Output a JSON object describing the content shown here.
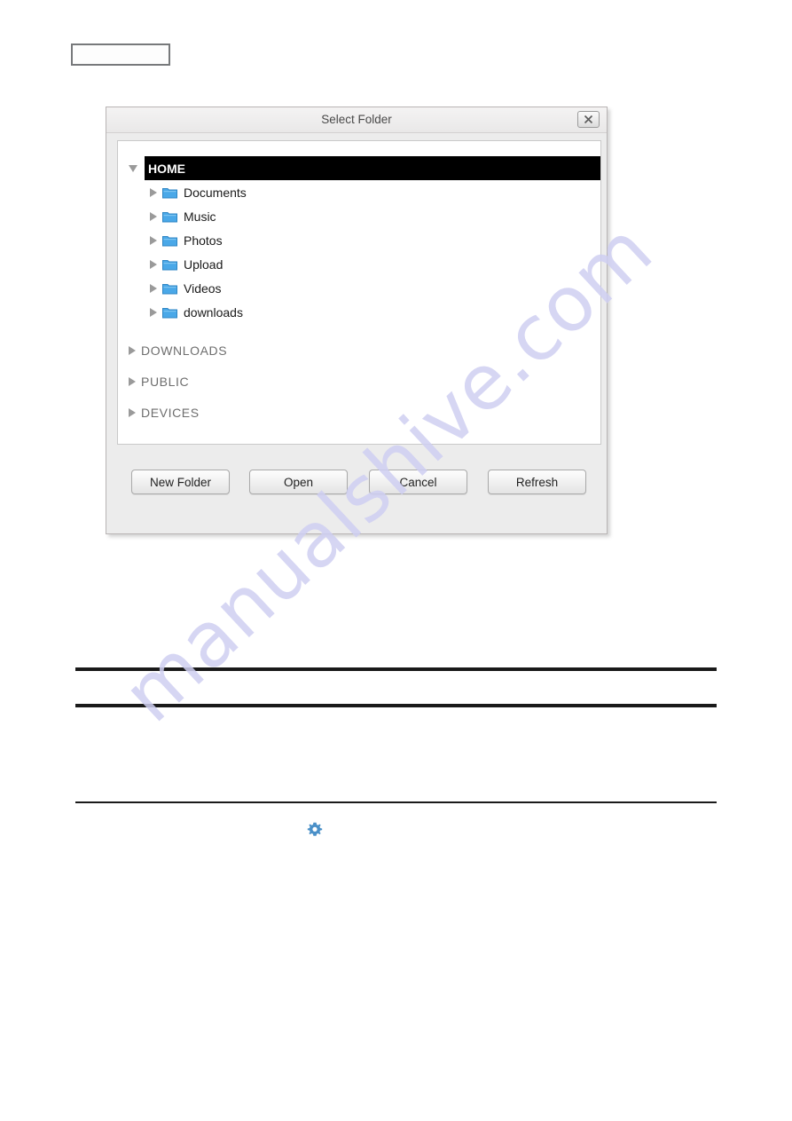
{
  "page": {
    "watermark_text": "manualshive.com",
    "watermark_color": "#cfcff2"
  },
  "top_field": {
    "value": "",
    "placeholder": ""
  },
  "dialog": {
    "title": "Select Folder",
    "close_icon": "close-icon",
    "tree": {
      "root": {
        "label": "HOME",
        "selected": true,
        "expanded": true,
        "twisty": "chevron-down-icon"
      },
      "children": [
        {
          "label": "Documents",
          "icon": "folder-icon",
          "twisty": "chevron-right-icon",
          "expanded": false
        },
        {
          "label": "Music",
          "icon": "folder-icon",
          "twisty": "chevron-right-icon",
          "expanded": false
        },
        {
          "label": "Photos",
          "icon": "folder-icon",
          "twisty": "chevron-right-icon",
          "expanded": false
        },
        {
          "label": "Upload",
          "icon": "folder-icon",
          "twisty": "chevron-right-icon",
          "expanded": false
        },
        {
          "label": "Videos",
          "icon": "folder-icon",
          "twisty": "chevron-right-icon",
          "expanded": false
        },
        {
          "label": "downloads",
          "icon": "folder-icon",
          "twisty": "chevron-right-icon",
          "expanded": false
        }
      ],
      "groups": [
        {
          "label": "DOWNLOADS",
          "twisty": "chevron-right-icon",
          "expanded": false
        },
        {
          "label": "PUBLIC",
          "twisty": "chevron-right-icon",
          "expanded": false
        },
        {
          "label": "DEVICES",
          "twisty": "chevron-right-icon",
          "expanded": false
        }
      ]
    },
    "buttons": [
      {
        "label": "New Folder"
      },
      {
        "label": "Open"
      },
      {
        "label": "Cancel"
      },
      {
        "label": "Refresh"
      }
    ]
  },
  "document": {
    "gear_icon": "gear-icon",
    "gear_color": "#4a90c8"
  },
  "colors": {
    "selection_background": "#000000",
    "selection_text": "#ffffff",
    "folder_blue": "#4aa8e8",
    "dialog_background": "#ececec",
    "accent": "#4a90c8"
  }
}
